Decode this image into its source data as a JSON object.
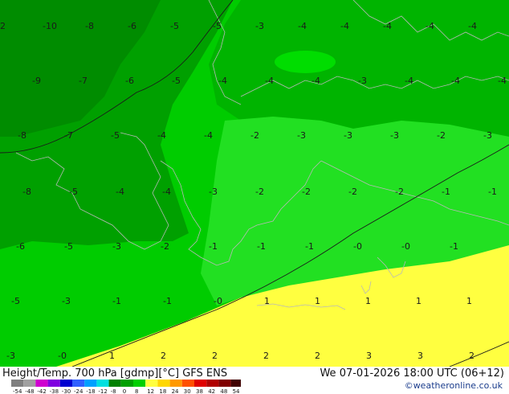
{
  "title": "Height/Temp. 700 hPa [gdmp][°C] GFS ENS",
  "valid_time": "We 07-01-2026 18:00 UTC (06+12)",
  "credit": "©weatheronline.co.uk",
  "legend": {
    "ticks": [
      "-54",
      "-48",
      "-42",
      "-38",
      "-30",
      "-24",
      "-18",
      "-12",
      "-8",
      "0",
      "8",
      "12",
      "18",
      "24",
      "30",
      "38",
      "42",
      "48",
      "54"
    ],
    "colors": [
      "#808080",
      "#a0a0a0",
      "#d000d0",
      "#8000e0",
      "#0000d0",
      "#3060ff",
      "#00a0ff",
      "#00e0e0",
      "#008000",
      "#00a000",
      "#00d000",
      "#ffff40",
      "#ffd700",
      "#ff9900",
      "#ff5000",
      "#e00000",
      "#b00000",
      "#800000",
      "#400000"
    ]
  },
  "temperature_labels": [
    {
      "text": "2",
      "col": 0,
      "row": 0
    },
    {
      "text": "-10",
      "col": 1,
      "row": 0
    },
    {
      "text": "-8",
      "col": 2,
      "row": 0
    },
    {
      "text": "-6",
      "col": 3,
      "row": 0
    },
    {
      "text": "-5",
      "col": 4,
      "row": 0
    },
    {
      "text": "-5",
      "col": 5,
      "row": 0
    },
    {
      "text": "-3",
      "col": 6,
      "row": 0
    },
    {
      "text": "-4",
      "col": 7,
      "row": 0
    },
    {
      "text": "-4",
      "col": 8,
      "row": 0
    },
    {
      "text": "-4",
      "col": 9,
      "row": 0
    },
    {
      "text": "-4",
      "col": 10,
      "row": 0
    },
    {
      "text": "-4",
      "col": 11,
      "row": 0
    },
    {
      "text": "-9",
      "col": 0,
      "row": 1
    },
    {
      "text": "-7",
      "col": 1,
      "row": 1
    },
    {
      "text": "-6",
      "col": 2,
      "row": 1
    },
    {
      "text": "-5",
      "col": 3,
      "row": 1
    },
    {
      "text": "-4",
      "col": 4,
      "row": 1
    },
    {
      "text": "-4",
      "col": 5,
      "row": 1
    },
    {
      "text": "-4",
      "col": 6,
      "row": 1
    },
    {
      "text": "-3",
      "col": 7,
      "row": 1
    },
    {
      "text": "-4",
      "col": 8,
      "row": 1
    },
    {
      "text": "-4",
      "col": 9,
      "row": 1
    },
    {
      "text": "-4",
      "col": 10,
      "row": 1
    },
    {
      "text": "-8",
      "col": 0,
      "row": 2
    },
    {
      "text": "-7",
      "col": 1,
      "row": 2
    },
    {
      "text": "-5",
      "col": 2,
      "row": 2
    },
    {
      "text": "-4",
      "col": 3,
      "row": 2
    },
    {
      "text": "-4",
      "col": 4,
      "row": 2
    },
    {
      "text": "-2",
      "col": 5,
      "row": 2
    },
    {
      "text": "-3",
      "col": 6,
      "row": 2
    },
    {
      "text": "-3",
      "col": 7,
      "row": 2
    },
    {
      "text": "-3",
      "col": 8,
      "row": 2
    },
    {
      "text": "-2",
      "col": 9,
      "row": 2
    },
    {
      "text": "-3",
      "col": 10,
      "row": 2
    },
    {
      "text": "-8",
      "col": 0,
      "row": 3
    },
    {
      "text": "-5",
      "col": 1,
      "row": 3
    },
    {
      "text": "-4",
      "col": 2,
      "row": 3
    },
    {
      "text": "-4",
      "col": 3,
      "row": 3
    },
    {
      "text": "-3",
      "col": 4,
      "row": 3
    },
    {
      "text": "-2",
      "col": 5,
      "row": 3
    },
    {
      "text": "-2",
      "col": 6,
      "row": 3
    },
    {
      "text": "-2",
      "col": 7,
      "row": 3
    },
    {
      "text": "-2",
      "col": 8,
      "row": 3
    },
    {
      "text": "-1",
      "col": 9,
      "row": 3
    },
    {
      "text": "-1",
      "col": 10,
      "row": 3
    },
    {
      "text": "-6",
      "col": 0,
      "row": 4
    },
    {
      "text": "-5",
      "col": 1,
      "row": 4
    },
    {
      "text": "-3",
      "col": 2,
      "row": 4
    },
    {
      "text": "-2",
      "col": 3,
      "row": 4
    },
    {
      "text": "-1",
      "col": 4,
      "row": 4
    },
    {
      "text": "-1",
      "col": 5,
      "row": 4
    },
    {
      "text": "-1",
      "col": 6,
      "row": 4
    },
    {
      "text": "-0",
      "col": 7,
      "row": 4
    },
    {
      "text": "-0",
      "col": 8,
      "row": 4
    },
    {
      "text": "-1",
      "col": 9,
      "row": 4
    },
    {
      "text": "-5",
      "col": 0,
      "row": 5
    },
    {
      "text": "-3",
      "col": 1,
      "row": 5
    },
    {
      "text": "-1",
      "col": 2,
      "row": 5
    },
    {
      "text": "-1",
      "col": 3,
      "row": 5
    },
    {
      "text": "-0",
      "col": 4,
      "row": 5
    },
    {
      "text": "1",
      "col": 5,
      "row": 5
    },
    {
      "text": "1",
      "col": 6,
      "row": 5
    },
    {
      "text": "1",
      "col": 7,
      "row": 5
    },
    {
      "text": "1",
      "col": 8,
      "row": 5
    },
    {
      "text": "1",
      "col": 9,
      "row": 5
    },
    {
      "text": "-3",
      "col": 0,
      "row": 6
    },
    {
      "text": "-0",
      "col": 1,
      "row": 6
    },
    {
      "text": "1",
      "col": 2,
      "row": 6
    },
    {
      "text": "2",
      "col": 3,
      "row": 6
    },
    {
      "text": "2",
      "col": 4,
      "row": 6
    },
    {
      "text": "2",
      "col": 5,
      "row": 6
    },
    {
      "text": "2",
      "col": 6,
      "row": 6
    },
    {
      "text": "3",
      "col": 7,
      "row": 6
    },
    {
      "text": "3",
      "col": 8,
      "row": 6
    },
    {
      "text": "2",
      "col": 9,
      "row": 6
    }
  ]
}
